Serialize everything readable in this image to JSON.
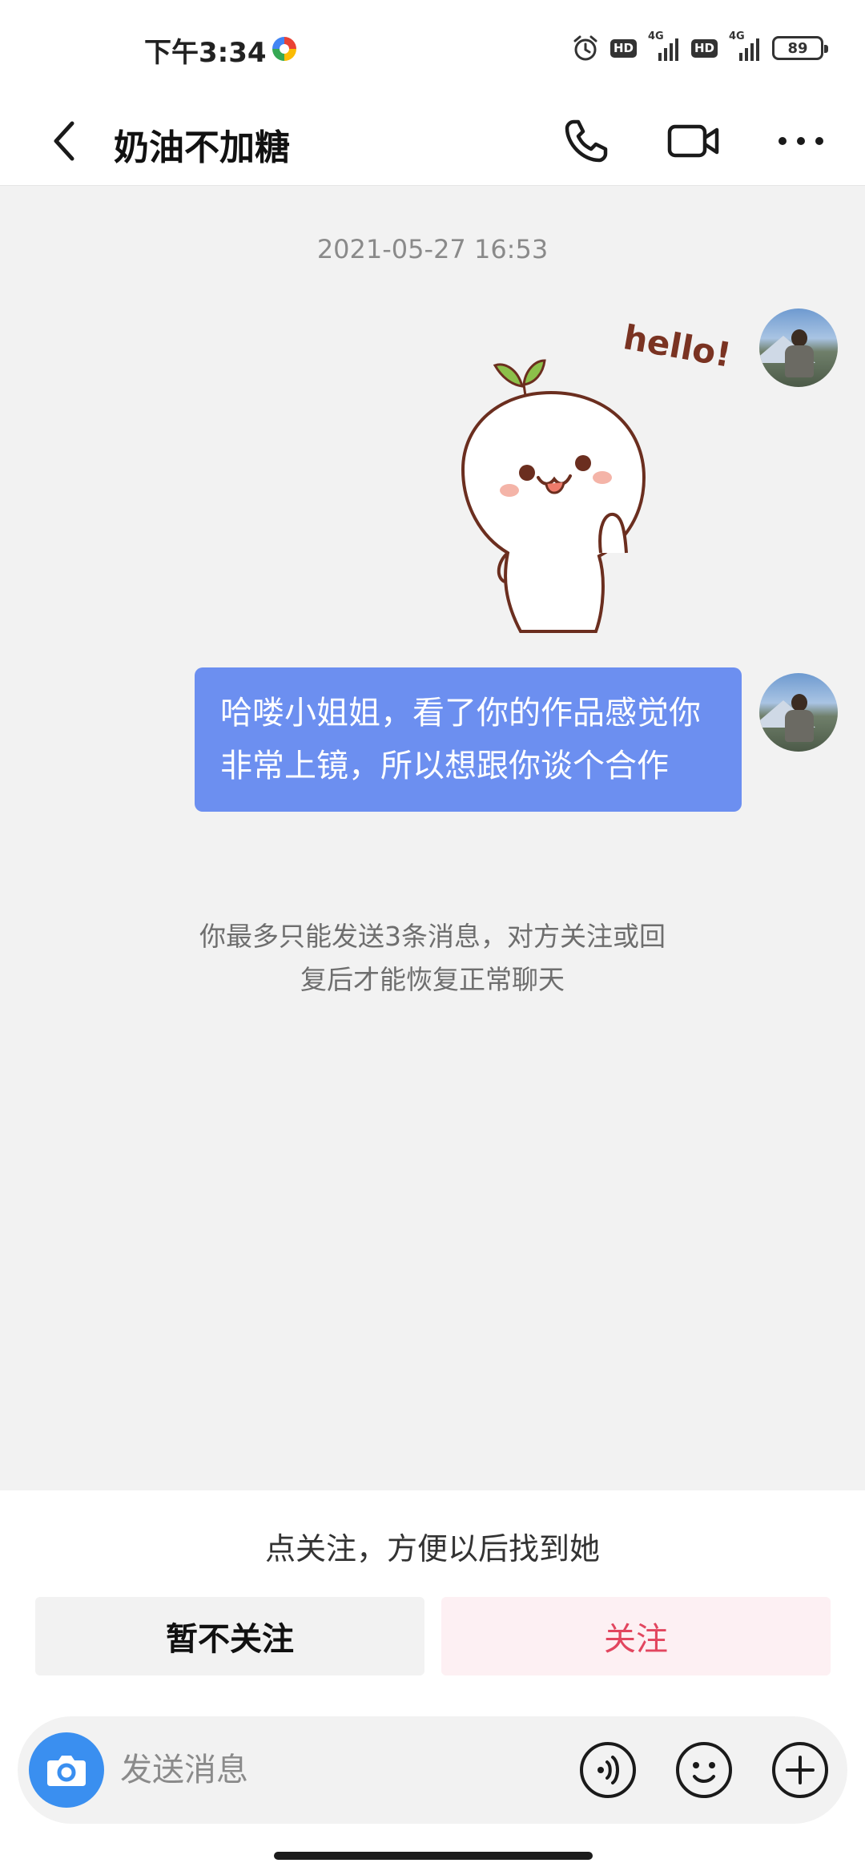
{
  "status_bar": {
    "time": "下午3:34",
    "hd1": "HD",
    "net1": "4G",
    "hd2": "HD",
    "net2": "4G",
    "battery": "89",
    "icons": [
      "app-notification-icon",
      "alarm-icon",
      "signal-icon",
      "battery-icon"
    ]
  },
  "header": {
    "title": "奶油不加糖",
    "icons": [
      "back-arrow-icon",
      "phone-icon",
      "video-camera-icon",
      "more-dots-icon"
    ]
  },
  "chat": {
    "timestamp": "2021-05-27 16:53",
    "sticker_text": "hello!",
    "message": "哈喽小姐姐，看了你的作品感觉你非常上镜，所以想跟你谈个合作",
    "system_note_line1": "你最多只能发送3条消息，对方关注或回",
    "system_note_line2": "复后才能恢复正常聊天"
  },
  "follow_panel": {
    "prompt": "点关注，方便以后找到她",
    "later_label": "暂不关注",
    "follow_label": "关注"
  },
  "input_bar": {
    "placeholder": "发送消息",
    "icons": [
      "camera-icon",
      "voice-icon",
      "emoji-icon",
      "plus-icon"
    ]
  },
  "colors": {
    "bubble": "#6c8ff0",
    "follow_text": "#e2465f",
    "follow_bg": "#fdf0f3",
    "camera_button": "#3a8ff0",
    "chat_bg": "#f2f2f2"
  }
}
